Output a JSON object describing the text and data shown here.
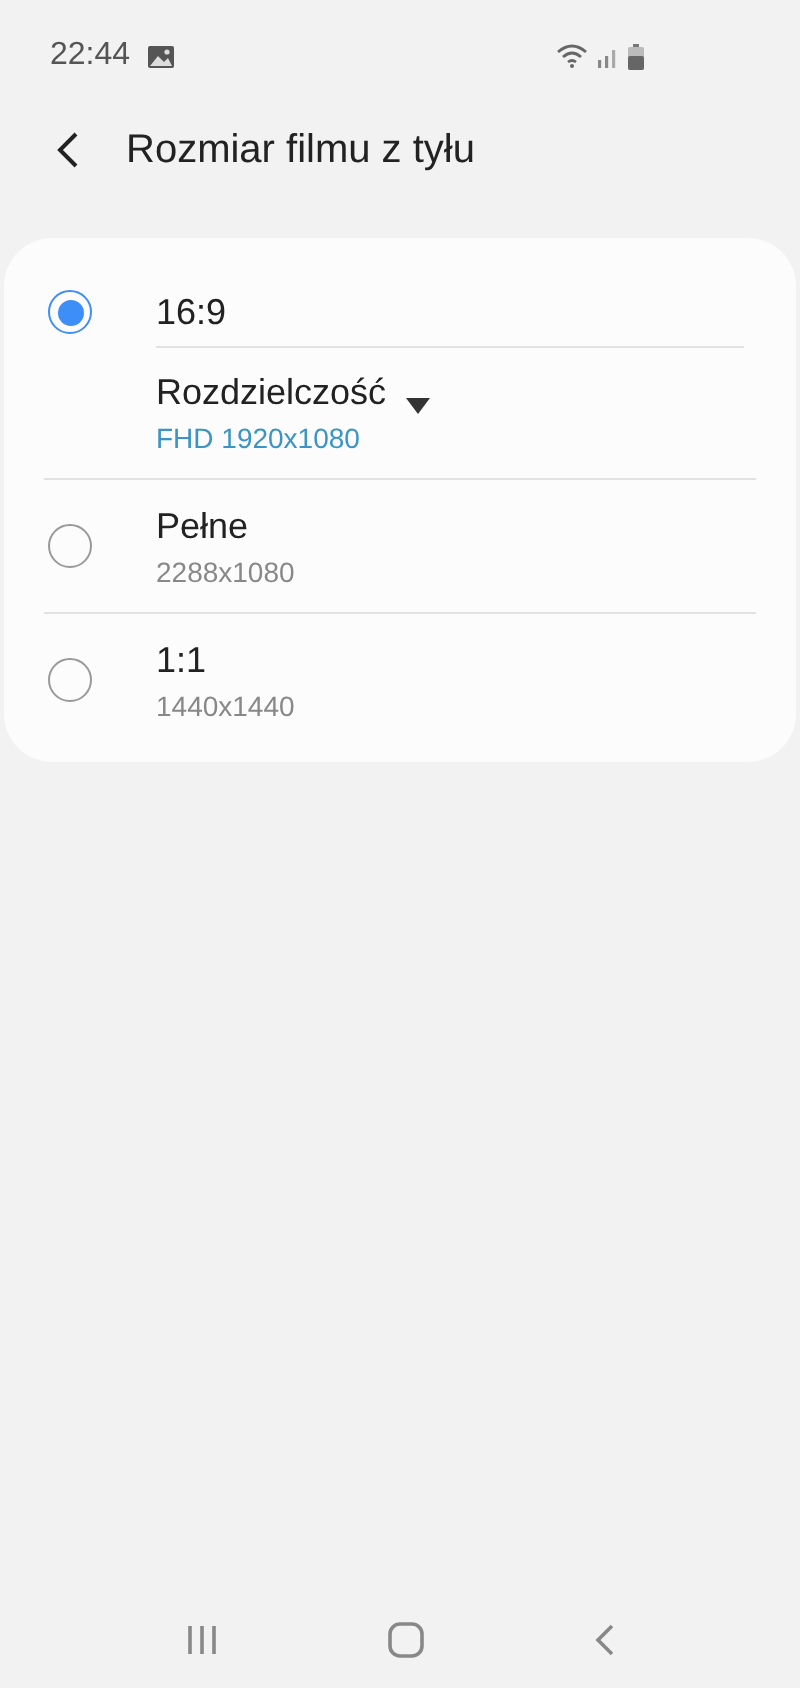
{
  "status_bar": {
    "time": "22:44"
  },
  "header": {
    "title": "Rozmiar filmu z tyłu"
  },
  "options": [
    {
      "label": "16:9",
      "selected": true,
      "setting": {
        "label": "Rozdzielczość",
        "value": "FHD 1920x1080"
      }
    },
    {
      "label": "Pełne",
      "selected": false,
      "detail": "2288x1080"
    },
    {
      "label": "1:1",
      "selected": false,
      "detail": "1440x1440"
    }
  ]
}
